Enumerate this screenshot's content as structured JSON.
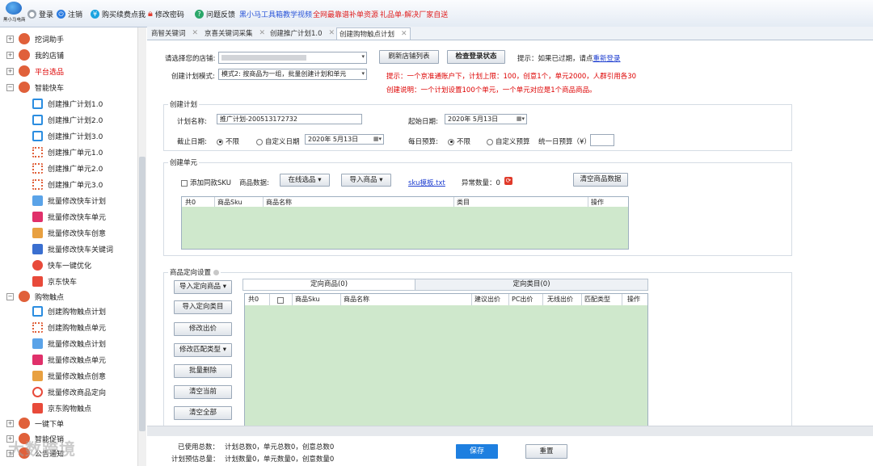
{
  "toolbar": {
    "logo_text": "黑小马电商",
    "items": [
      {
        "label": "登录",
        "color": "#9aa3ad"
      },
      {
        "label": "注销",
        "color": "#2b7be0"
      },
      {
        "label": "购买续费点我",
        "color": "#1aa3e0"
      },
      {
        "label": "修改密码",
        "color": "#e23c2f"
      },
      {
        "label": "问题反馈",
        "color": "#2aa76a"
      }
    ],
    "links": [
      {
        "label": "黑小马工具箱教学视频",
        "color": "#2a55d8"
      },
      {
        "label": "全网最靠谱补单资源",
        "color": "#e02020"
      },
      {
        "label": "礼品单-解决厂家自送",
        "color": "#e02020"
      }
    ]
  },
  "sidebar": {
    "groups": [
      {
        "label": "挖词助手",
        "color": "#e0603a"
      },
      {
        "label": "我的店铺",
        "color": "#e0603a"
      },
      {
        "label": "平台选品",
        "color": "#e0603a",
        "highlight": true
      },
      {
        "label": "智能快车",
        "color": "#e0603a",
        "expanded": true
      }
    ],
    "kuaiche_items": [
      "创建推广计划1.0",
      "创建推广计划2.0",
      "创建推广计划3.0",
      "创建推广单元1.0",
      "创建推广单元2.0",
      "创建推广单元3.0",
      "批量修改快车计划",
      "批量修改快车单元",
      "批量修改快车创意",
      "批量修改快车关键词",
      "快车一键优化",
      "京东快车"
    ],
    "chudian_group": "购物触点",
    "chudian_items": [
      "创建购物触点计划",
      "创建购物触点单元",
      "批量修改触点计划",
      "批量修改触点单元",
      "批量修改触点创意",
      "批量修改商品定向",
      "京东购物触点"
    ],
    "bottom_groups": [
      "一键下单",
      "智能促销",
      "公告通知"
    ]
  },
  "tabs": [
    {
      "label": "商智关键词",
      "active": false
    },
    {
      "label": "京喜关键词采集",
      "active": false
    },
    {
      "label": "创建推广计划1.0",
      "active": false
    },
    {
      "label": "创建购物触点计划",
      "active": true
    }
  ],
  "form": {
    "shop_label": "请选择您的店铺:",
    "refresh_button": "刷新店铺列表",
    "check_login_button": "检查登录状态",
    "hint_prefix": "提示：如果已过期，请点",
    "hint_link": "重新登录",
    "mode_label": "创建计划模式:",
    "mode_value": "模式2: 按商品为一组，批量创建计划和单元",
    "tip1": "提示：一个京准通账户下，计划上限：100，创意1个，单元2000，人群引用各30",
    "tip2": "创建说明：一个计划设置100个单元，一个单元对应是1个商品商品。",
    "plan_section": "创建计划",
    "plan_name_label": "计划名称:",
    "plan_name_value": "推广计划-200513172732",
    "start_date_label": "起始日期:",
    "start_date_value": "2020年 5月13日",
    "end_date_label": "截止日期:",
    "end_unlimited": "不限",
    "end_custom": "自定义日期",
    "end_date_value": "2020年 5月13日",
    "budget_label": "每日预算:",
    "budget_unlimited": "不限",
    "budget_custom": "自定义预算",
    "unified_budget_label": "统一日预算（¥）",
    "unit_section": "创建单元",
    "add_sku_label": "添加同款SKU",
    "goods_data_label": "商品数据:",
    "online_select": "在线选品",
    "import_goods": "导入商品",
    "sku_template_link": "sku模板.txt",
    "abnormal_label": "异常数量：0",
    "clear_goods_button": "清空商品数据",
    "unit_table_headers": [
      "共0",
      "商品Sku",
      "商品名称",
      "类目",
      "操作"
    ],
    "target_section": "商品定向设置",
    "target_buttons": [
      "导入定向商品",
      "导入定向类目",
      "修改出价",
      "修改匹配类型",
      "批量删除",
      "清空当前",
      "清空全部"
    ],
    "target_tabs": [
      "定向商品(0)",
      "定向类目(0)"
    ],
    "target_table_headers": [
      "共0",
      "商品Sku",
      "商品名称",
      "建议出价",
      "PC出价",
      "无线出价",
      "匹配类型",
      "操作"
    ]
  },
  "footer": {
    "used_label": "已使用总数：",
    "used_value": "计划总数0，单元总数0，创意总数0",
    "est_label": "计划预估总量：",
    "est_value": "计划数量0，单元数量0，创意数量0",
    "save_button": "保存",
    "reset_button": "重置"
  },
  "watermark": "大数跨境"
}
